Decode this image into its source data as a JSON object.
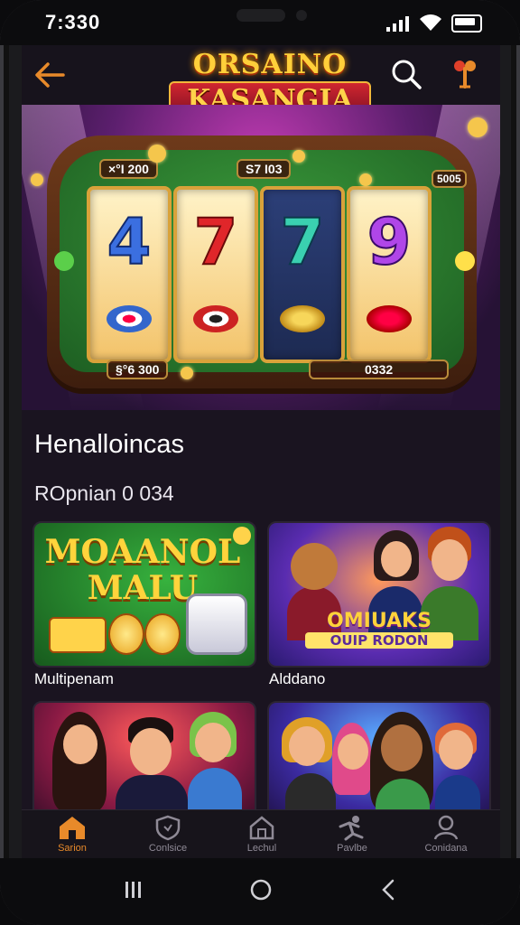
{
  "status": {
    "time": "7:330"
  },
  "header": {
    "brand_line1": "ORSAINO",
    "brand_line2": "KASANGIA"
  },
  "hero": {
    "reels": [
      "4",
      "7",
      "7",
      "9"
    ],
    "top_left_tag": "×°I 200",
    "top_center_tag": "S7 I03",
    "right_tag": "5005",
    "bottom_left_tag": "§°6 300",
    "bottom_right_tag": "0332"
  },
  "section": {
    "title": "Henalloincas",
    "subtitle": "ROpnian 0 034"
  },
  "cards": [
    {
      "title_line1": "MOAANOL",
      "title_line2": "MALU",
      "caption": "Multipenam"
    },
    {
      "title_line1": "OMIUAKS",
      "title_line2": "OUIP RODON",
      "caption": "Alddano"
    },
    {
      "caption": ""
    },
    {
      "caption": ""
    }
  ],
  "nav": [
    {
      "label": "Sarion",
      "active": true
    },
    {
      "label": "Conlsice",
      "active": false
    },
    {
      "label": "Lechul",
      "active": false
    },
    {
      "label": "Pavlbe",
      "active": false
    },
    {
      "label": "Conidana",
      "active": false
    }
  ],
  "colors": {
    "accent": "#e88a2a",
    "gold": "#ffcf3a",
    "felt": "#2f8a33"
  }
}
